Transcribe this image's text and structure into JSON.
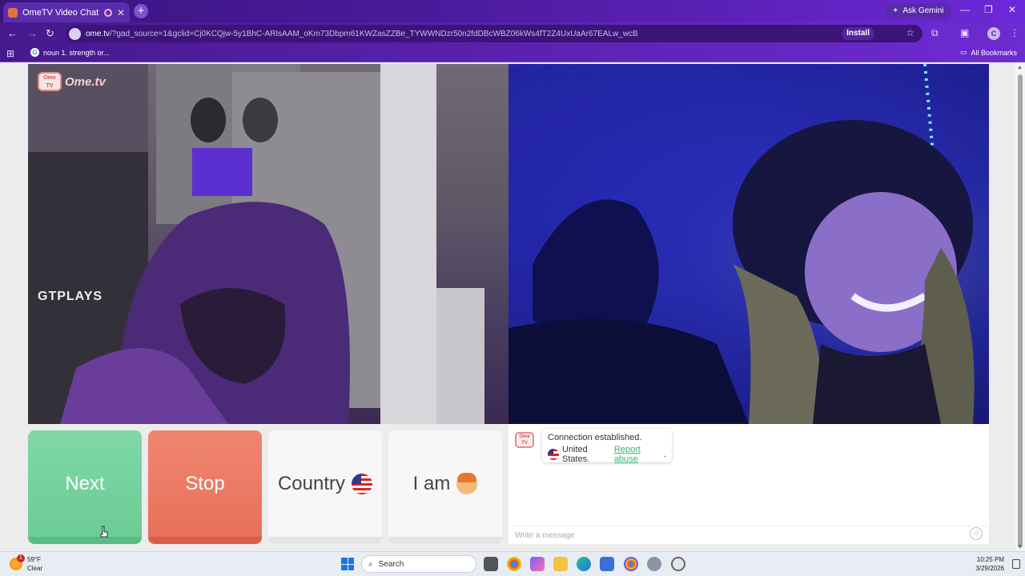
{
  "browser": {
    "tab_title": "OmeTV Video Chat — Ome",
    "new_tab": "+",
    "ask_gemini": "Ask Gemini",
    "url_host": "ome.tv",
    "url_rest": "/?gad_source=1&gclid=Cj0KCQjw-5y1BhC-ARIsAAM_oKm73Dbpm61KWZasZZBe_TYWWNDzr50n2fdDBcWBZ06kWs4fT2Z4UxUaAr67EALw_wcB",
    "install_label": "Install",
    "profile_initial": "C",
    "bookmark_item": "noun 1. strength or...",
    "all_bookmarks": "All Bookmarks"
  },
  "page": {
    "logo_badge": "Ome TV",
    "logo_name": "Ome.tv",
    "buttons": {
      "next": "Next",
      "stop": "Stop",
      "country": "Country",
      "iam": "I am"
    },
    "chat": {
      "logo_badge": "Ome TV",
      "status": "Connection established.",
      "country": "United States.",
      "report": "Report abuse",
      "report_suffix": ".",
      "placeholder": "Write a message"
    },
    "videos": {
      "local_overlay": "GTPLAYS"
    }
  },
  "taskbar": {
    "weather_temp": "59°F",
    "weather_desc": "Clear",
    "weather_badge": "1",
    "search_placeholder": "Search",
    "time": "10:25 PM",
    "date": "3/29/2026"
  },
  "colors": {
    "next": "#6ccc96",
    "stop": "#e8705a",
    "link": "#3fae7a",
    "browser_accent": "#5b21b6"
  }
}
